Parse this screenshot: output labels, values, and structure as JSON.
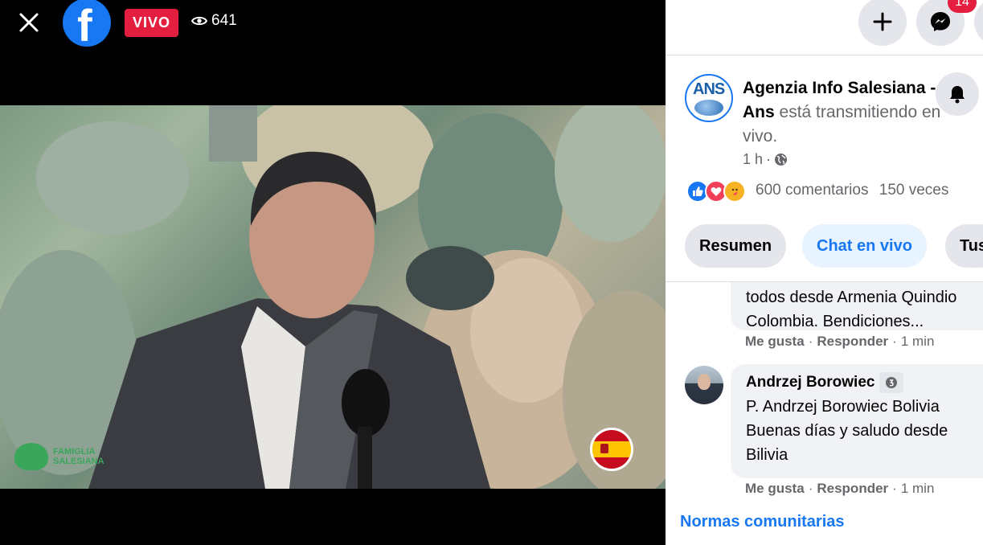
{
  "video": {
    "live_label": "VIVO",
    "viewer_count": "641",
    "watermark": "FAMIGLIA SALESIANA"
  },
  "topbar": {
    "notification_count": "14"
  },
  "post": {
    "page_name": "Agenzia Info Salesiana - Ans",
    "status_text": "está transmitiendo en vivo.",
    "time": "1 h",
    "dot": "·",
    "comments_count": "600 comentarios",
    "shares_count": "150 veces"
  },
  "tabs": {
    "resumen": "Resumen",
    "chat": "Chat en vivo",
    "tus": "Tus"
  },
  "comments": [
    {
      "text_line1": "todos desde Armenia Quindio",
      "text_line2": "Colombia. Bendiciones...",
      "like": "Me gusta",
      "reply": "Responder",
      "time": "1 min"
    },
    {
      "author": "Andrzej Borowiec",
      "text_line1": "P. Andrzej Borowiec Bolivia",
      "text_line2": "Buenas días y saludo desde",
      "text_line3": "Bilivia",
      "like": "Me gusta",
      "reply": "Responder",
      "time": "1 min"
    }
  ],
  "footer": {
    "community_standards": "Normas comunitarias"
  },
  "colors": {
    "facebook_blue": "#1877f2",
    "live_red": "#e41e3f",
    "chip_gray": "#e4e6eb"
  }
}
